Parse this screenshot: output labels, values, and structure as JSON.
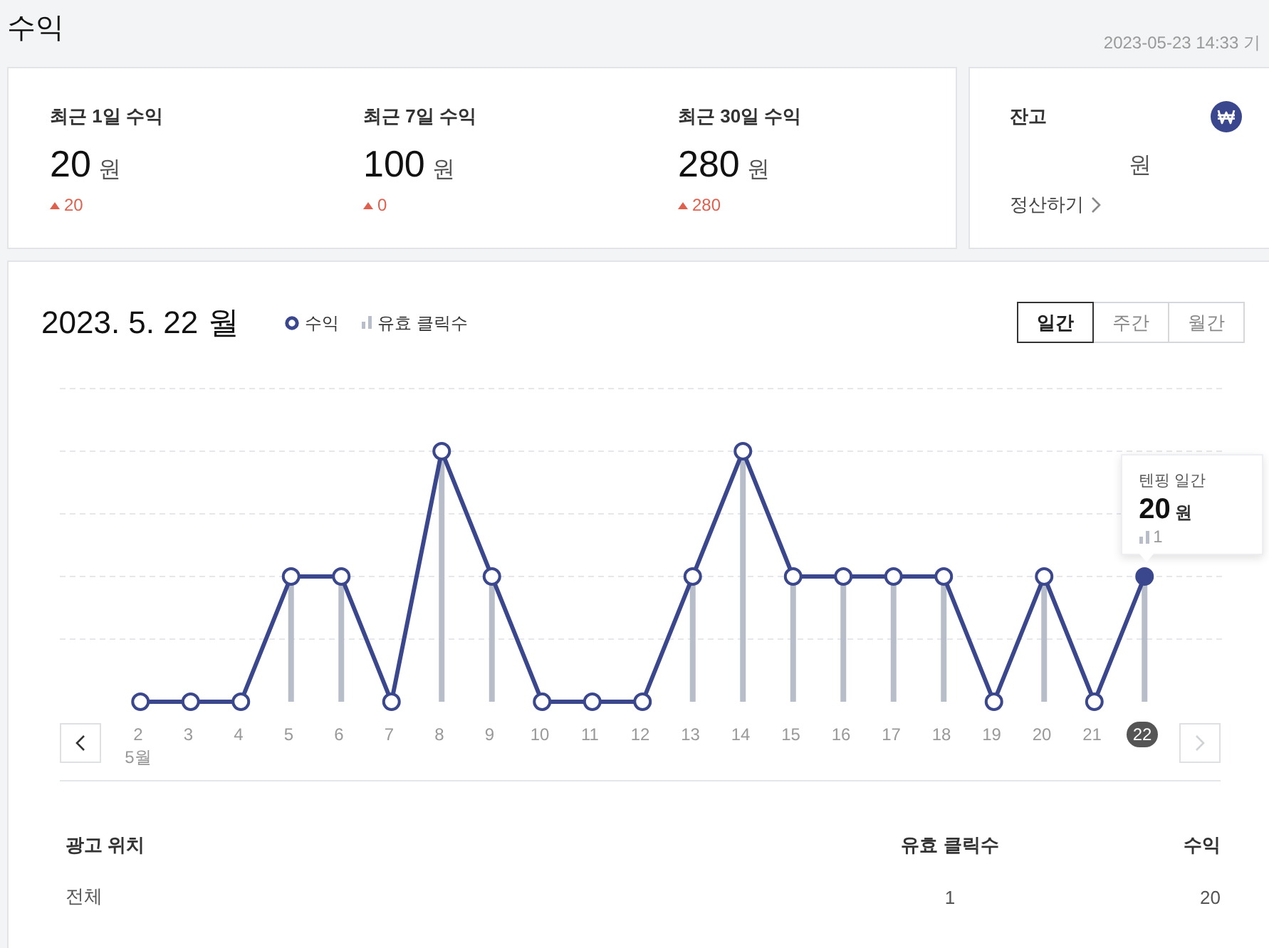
{
  "page": {
    "title": "수익",
    "updated": "2023-05-23 14:33 기"
  },
  "summary": [
    {
      "label": "최근 1일 수익",
      "value": "20",
      "unit": "원",
      "change": "20"
    },
    {
      "label": "최근 7일 수익",
      "value": "100",
      "unit": "원",
      "change": "0"
    },
    {
      "label": "최근 30일 수익",
      "value": "280",
      "unit": "원",
      "change": "280"
    }
  ],
  "balance": {
    "label": "잔고",
    "unit": "원",
    "link": "정산하기"
  },
  "report": {
    "date": "2023. 5. 22",
    "weekday": "월",
    "legend": [
      {
        "kind": "line",
        "label": "수익"
      },
      {
        "kind": "bar",
        "label": "유효 클릭수"
      }
    ],
    "periods": [
      {
        "label": "일간",
        "selected": true
      },
      {
        "label": "주간",
        "selected": false
      },
      {
        "label": "월간",
        "selected": false
      }
    ]
  },
  "chart": {
    "prev": {
      "disabled": false
    },
    "next": {
      "disabled": true
    },
    "days": [
      {
        "label": "2",
        "month": "5월",
        "selected": false
      },
      {
        "label": "3",
        "selected": false
      },
      {
        "label": "4",
        "selected": false
      },
      {
        "label": "5",
        "selected": false
      },
      {
        "label": "6",
        "selected": false
      },
      {
        "label": "7",
        "selected": false
      },
      {
        "label": "8",
        "selected": false
      },
      {
        "label": "9",
        "selected": false
      },
      {
        "label": "10",
        "selected": false
      },
      {
        "label": "11",
        "selected": false
      },
      {
        "label": "12",
        "selected": false
      },
      {
        "label": "13",
        "selected": false
      },
      {
        "label": "14",
        "selected": false
      },
      {
        "label": "15",
        "selected": false
      },
      {
        "label": "16",
        "selected": false
      },
      {
        "label": "17",
        "selected": false
      },
      {
        "label": "18",
        "selected": false
      },
      {
        "label": "19",
        "selected": false
      },
      {
        "label": "20",
        "selected": false
      },
      {
        "label": "21",
        "selected": false
      },
      {
        "label": "22",
        "selected": true
      }
    ],
    "tooltip": {
      "title": "텐핑 일간",
      "value": "20",
      "unit": "원",
      "clicks": "1"
    }
  },
  "table": {
    "columns": [
      "광고 위치",
      "유효 클릭수",
      "수익"
    ],
    "rows": [
      [
        "전체",
        "1",
        "20"
      ]
    ]
  }
}
